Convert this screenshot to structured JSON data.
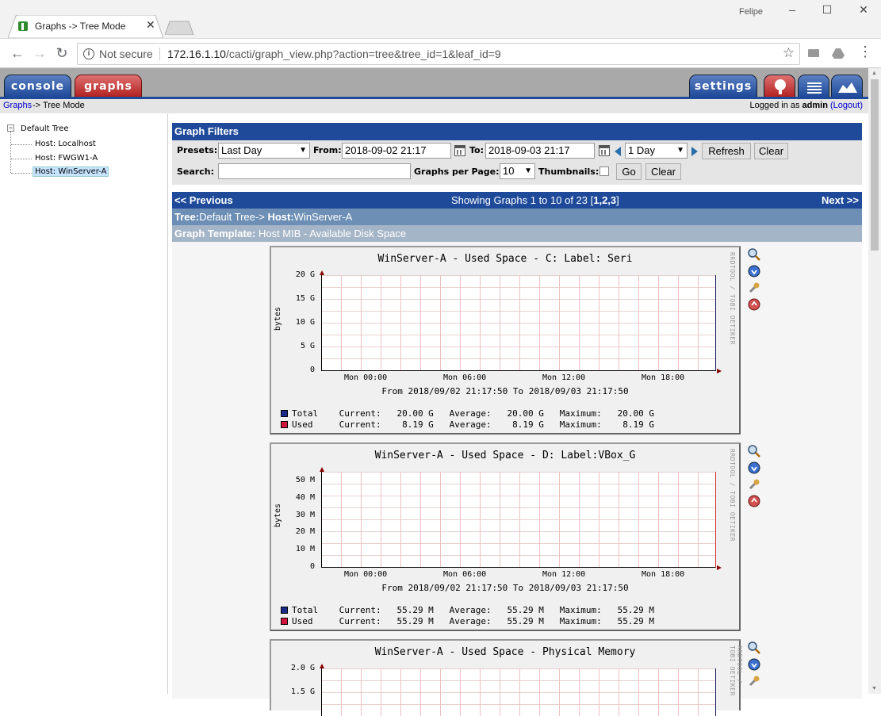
{
  "browser": {
    "tab_title": "Graphs -> Tree Mode",
    "window_user": "Felipe",
    "security_label": "Not secure",
    "url_host": "172.16.1.10",
    "url_path": "/cacti/graph_view.php?action=tree&tree_id=1&leaf_id=9"
  },
  "cacti_tabs": {
    "console": "console",
    "graphs": "graphs",
    "settings": "settings"
  },
  "breadcrumb": {
    "link": "Graphs",
    "rest": "-> Tree Mode",
    "logged_prefix": "Logged in as",
    "user": "admin",
    "logout": "(Logout)"
  },
  "tree": {
    "root": "Default Tree",
    "hosts": [
      "Host: Localhost",
      "Host: FWGW1-A",
      "Host: WinServer-A"
    ],
    "selected_index": 2
  },
  "filters": {
    "title": "Graph Filters",
    "presets_label": "Presets:",
    "presets_value": "Last Day",
    "from_label": "From:",
    "from_value": "2018-09-02 21:17",
    "to_label": "To:",
    "to_value": "2018-09-03 21:17",
    "timespan_value": "1 Day",
    "refresh": "Refresh",
    "clear": "Clear",
    "search_label": "Search:",
    "search_value": "",
    "per_page_label": "Graphs per Page:",
    "per_page_value": "10",
    "thumbnails_label": "Thumbnails:",
    "go": "Go",
    "clear2": "Clear"
  },
  "nav": {
    "previous": "<< Previous",
    "showing_prefix": "Showing Graphs 1 to 10 of 23 [",
    "pages": "1,2,3",
    "showing_suffix": "]",
    "next": "Next >>"
  },
  "tree_bar": {
    "tree_label": "Tree:",
    "tree_value": "Default Tree->",
    "host_label": "Host:",
    "host_value": "WinServer-A"
  },
  "template_bar": {
    "label": "Graph Template:",
    "value": "Host MIB - Available Disk Space"
  },
  "colors": {
    "total": "#1a2a8a",
    "used": "#d0143c",
    "header_blue": "#1f4a9a"
  },
  "graphs": [
    {
      "title": "WinServer-A - Used Space - C: Label:  Seri",
      "ylabel": "bytes",
      "yticks": [
        "20 G",
        "15 G",
        "10 G",
        "5 G",
        "0"
      ],
      "xticks": [
        "Mon 00:00",
        "Mon 06:00",
        "Mon 12:00",
        "Mon 18:00"
      ],
      "period": "From 2018/09/02 21:17:50 To 2018/09/03 21:17:50",
      "legend_total": "Total    Current:   20.00 G   Average:   20.00 G   Maximum:   20.00 G",
      "legend_used": "Used     Current:    8.19 G   Average:    8.19 G   Maximum:    8.19 G",
      "watermark": "RRDTOOL / TOBI OETIKER"
    },
    {
      "title": "WinServer-A - Used Space - D: Label:VBox_G",
      "ylabel": "bytes",
      "yticks": [
        "50 M",
        "40 M",
        "30 M",
        "20 M",
        "10 M",
        "0"
      ],
      "xticks": [
        "Mon 00:00",
        "Mon 06:00",
        "Mon 12:00",
        "Mon 18:00"
      ],
      "period": "From 2018/09/02 21:17:50 To 2018/09/03 21:17:50",
      "legend_total": "Total    Current:   55.29 M   Average:   55.29 M   Maximum:   55.29 M",
      "legend_used": "Used     Current:   55.29 M   Average:   55.29 M   Maximum:   55.29 M",
      "watermark": "RRDTOOL / TOBI OETIKER"
    },
    {
      "title": "WinServer-A - Used Space - Physical Memory",
      "ylabel": "",
      "yticks": [
        "2.0 G",
        "1.5 G"
      ],
      "xticks": [],
      "period": "",
      "legend_total": "",
      "legend_used": "",
      "watermark": "RRDTOOL / TOBI OETIKER"
    }
  ],
  "graph_icons": [
    "zoom-icon",
    "download-icon",
    "properties-icon",
    "go-to-top-icon"
  ]
}
